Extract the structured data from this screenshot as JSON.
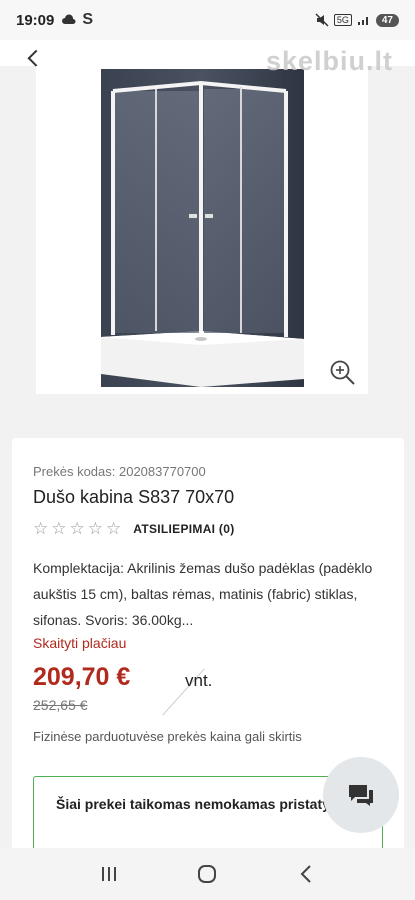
{
  "status_bar": {
    "time": "19:09",
    "carrier_letter": "S",
    "battery": "47",
    "network_label": "5G"
  },
  "watermark": "skelbiu.lt",
  "product": {
    "sku": "Prekės kodas: 202083770700",
    "title": "Dušo kabina S837 70x70",
    "reviews_label": "ATSILIEPIMAI (0)",
    "rating": 0,
    "description": "Komplektacija: Akrilinis žemas dušo padėklas (padėklo aukštis 15 cm), baltas rėmas, matinis (fabric) stiklas, sifonas. Svoris: 36.00kg...",
    "read_more": "Skaityti plačiau",
    "price": "209,70 €",
    "old_price": "252,65 €",
    "unit": "vnt.",
    "price_note": "Fizinėse parduotuvėse prekės kaina gali skirtis",
    "shipping": "Šiai prekei taikomas nemokamas pristatymas"
  },
  "icons": {
    "zoom": "zoom-in-icon",
    "chat": "chat-icon",
    "nav_recents": "recents-icon",
    "nav_home": "home-icon",
    "nav_back": "back-icon"
  },
  "colors": {
    "accent_red": "#b02a1e",
    "shipping_border": "#4caf50"
  }
}
